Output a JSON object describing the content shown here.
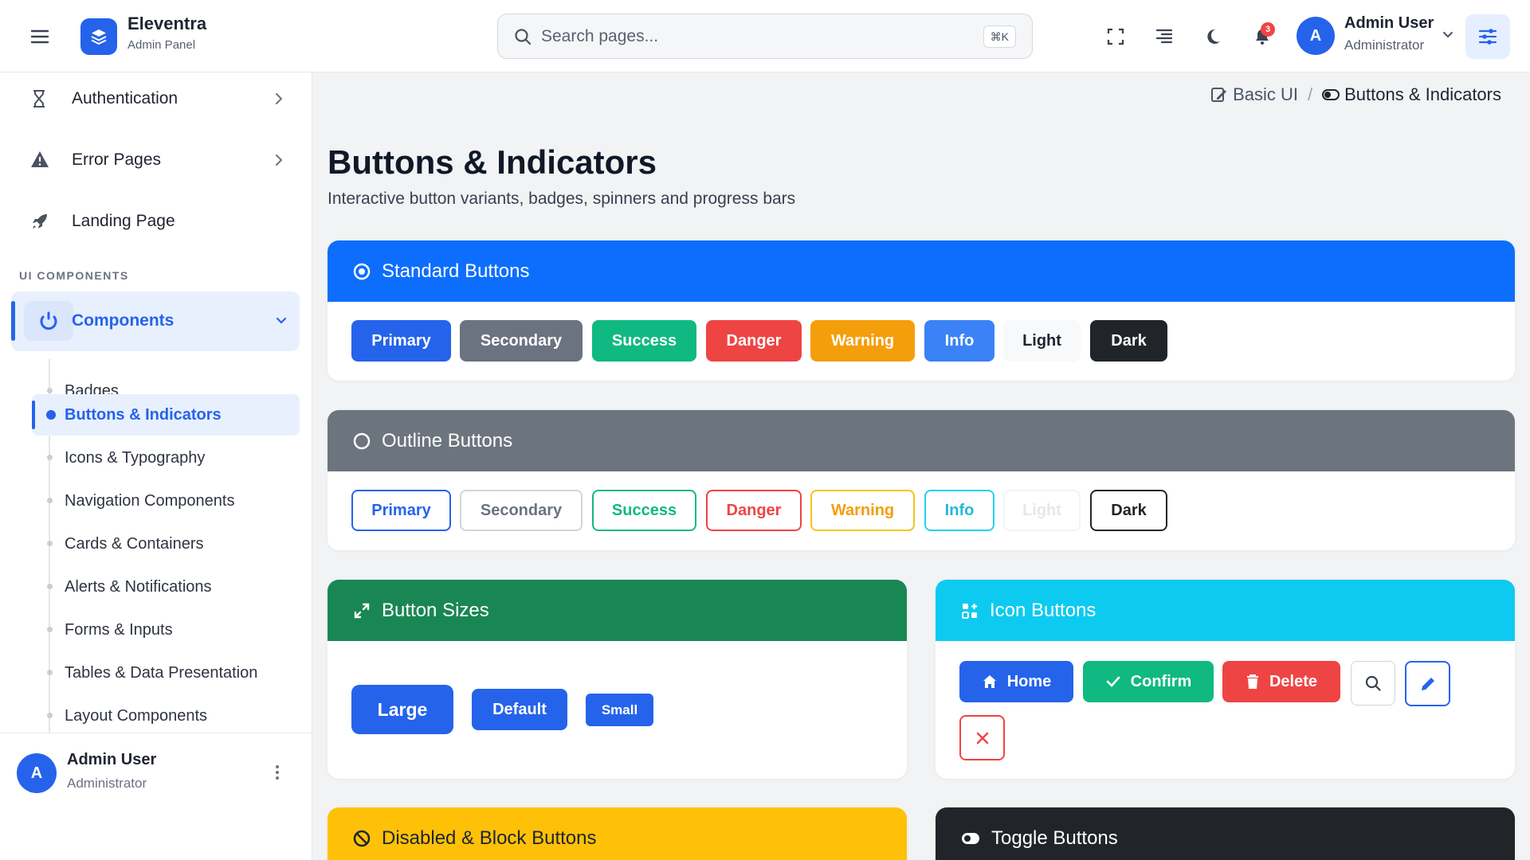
{
  "header": {
    "brand_title": "Eleventra",
    "brand_subtitle": "Admin Panel",
    "search_placeholder": "Search pages...",
    "search_shortcut": "⌘K",
    "notification_count": "3",
    "user_initial": "A",
    "user_name": "Admin User",
    "user_role": "Administrator"
  },
  "sidebar": {
    "items": [
      {
        "label": "Authentication",
        "icon": "hourglass-icon"
      },
      {
        "label": "Error Pages",
        "icon": "warning-icon"
      },
      {
        "label": "Landing Page",
        "icon": "rocket-icon"
      }
    ],
    "section_label": "UI COMPONENTS",
    "components_label": "Components",
    "sub_items": [
      "Badges",
      "Buttons & Indicators",
      "Icons & Typography",
      "Navigation Components",
      "Cards & Containers",
      "Alerts & Notifications",
      "Forms & Inputs",
      "Tables & Data Presentation",
      "Layout Components"
    ],
    "active_sub_item": "Buttons & Indicators",
    "footer": {
      "initial": "A",
      "name": "Admin User",
      "role": "Administrator"
    }
  },
  "breadcrumb": {
    "parent": "Basic UI",
    "current": "Buttons & Indicators"
  },
  "page": {
    "title": "Buttons & Indicators",
    "subtitle": "Interactive button variants, badges, spinners and progress bars"
  },
  "cards": {
    "standard": {
      "title": "Standard Buttons",
      "header_color": "#0d6efd",
      "buttons": [
        "Primary",
        "Secondary",
        "Success",
        "Danger",
        "Warning",
        "Info",
        "Light",
        "Dark"
      ]
    },
    "outline": {
      "title": "Outline Buttons",
      "header_color": "#6c757d",
      "buttons": [
        "Primary",
        "Secondary",
        "Success",
        "Danger",
        "Warning",
        "Info",
        "Light",
        "Dark"
      ]
    },
    "sizes": {
      "title": "Button Sizes",
      "header_color": "#198754",
      "buttons": [
        "Large",
        "Default",
        "Small"
      ]
    },
    "icon_buttons": {
      "title": "Icon Buttons",
      "header_color": "#0dcaf0",
      "buttons": [
        {
          "label": "Home",
          "icon": "home-icon"
        },
        {
          "label": "Confirm",
          "icon": "check-icon"
        },
        {
          "label": "Delete",
          "icon": "trash-icon"
        }
      ],
      "icon_only": [
        "search-icon",
        "pencil-icon",
        "close-icon"
      ]
    },
    "disabled": {
      "title": "Disabled & Block Buttons",
      "header_color": "#ffc107"
    },
    "toggle": {
      "title": "Toggle Buttons",
      "header_color": "#212529"
    }
  }
}
